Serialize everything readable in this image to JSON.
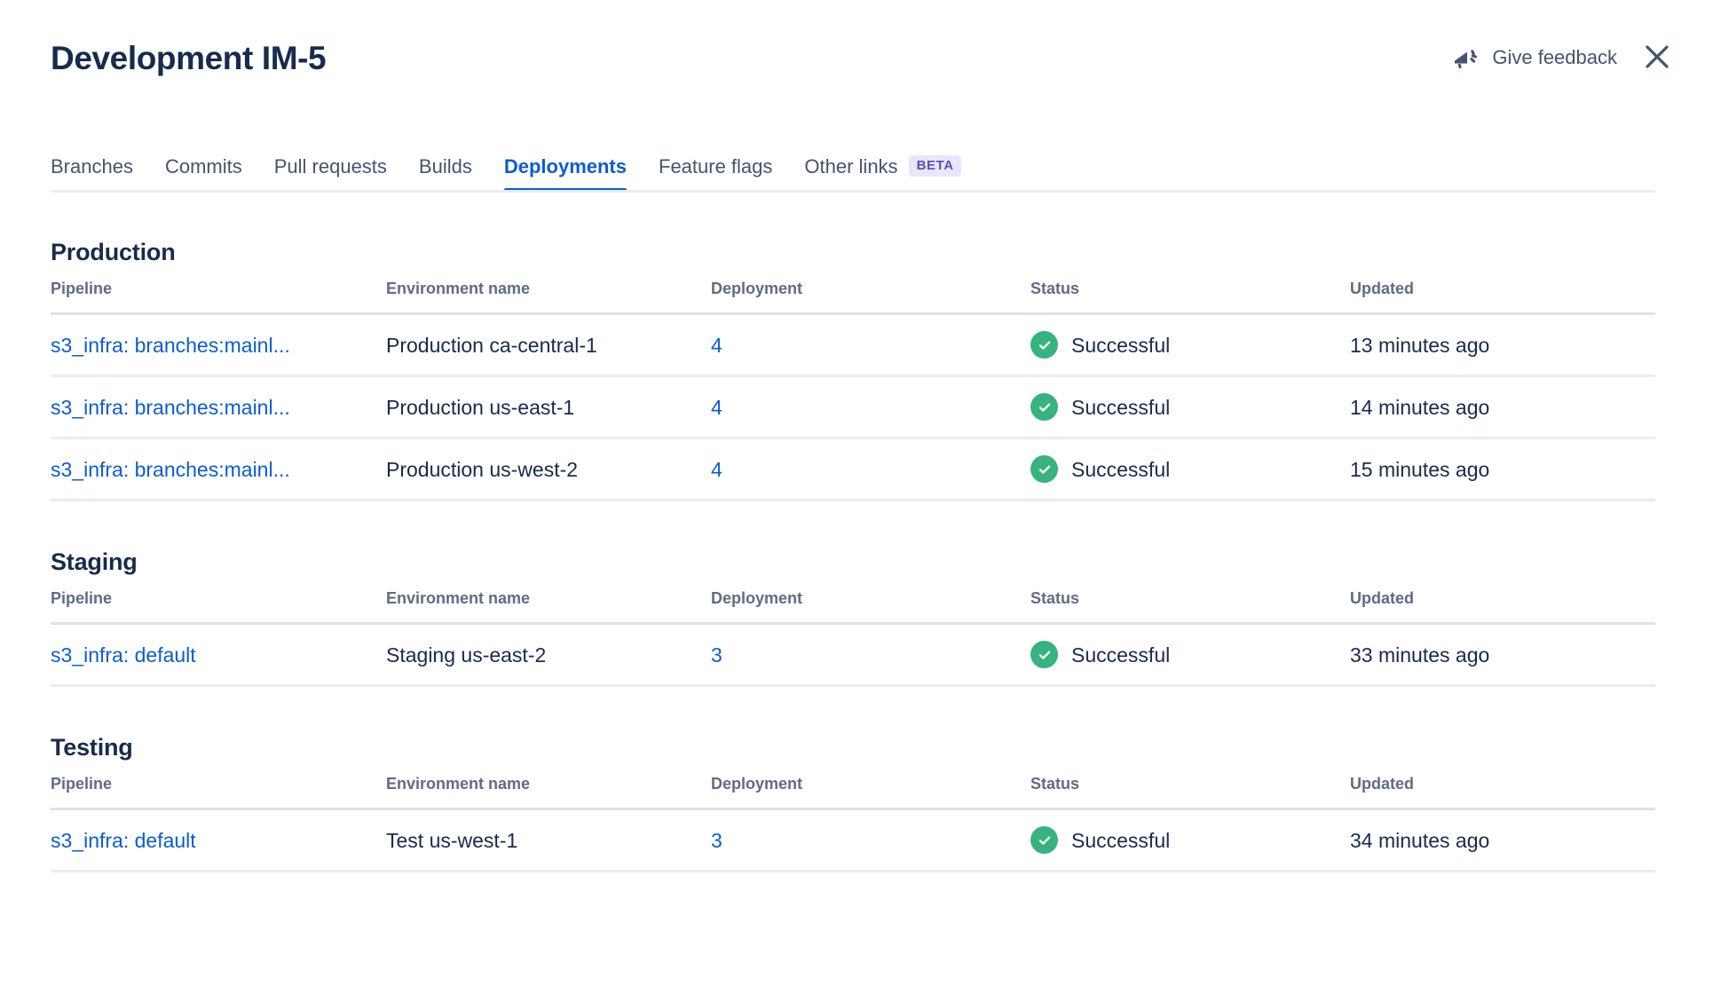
{
  "header": {
    "title": "Development IM-5",
    "feedback_label": "Give feedback",
    "feedback_icon": "megaphone-icon",
    "close_icon": "close-icon"
  },
  "tabs": [
    {
      "label": "Branches",
      "active": false,
      "badge": null
    },
    {
      "label": "Commits",
      "active": false,
      "badge": null
    },
    {
      "label": "Pull requests",
      "active": false,
      "badge": null
    },
    {
      "label": "Builds",
      "active": false,
      "badge": null
    },
    {
      "label": "Deployments",
      "active": true,
      "badge": null
    },
    {
      "label": "Feature flags",
      "active": false,
      "badge": null
    },
    {
      "label": "Other links",
      "active": false,
      "badge": "BETA"
    }
  ],
  "columns": [
    "Pipeline",
    "Environment name",
    "Deployment",
    "Status",
    "Updated"
  ],
  "sections": [
    {
      "title": "Production",
      "rows": [
        {
          "pipeline": "s3_infra: branches:mainl...",
          "environment": "Production ca-central-1",
          "deployment": "4",
          "status": "Successful",
          "status_icon": "check-circle-icon",
          "updated": "13 minutes ago"
        },
        {
          "pipeline": "s3_infra: branches:mainl...",
          "environment": "Production us-east-1",
          "deployment": "4",
          "status": "Successful",
          "status_icon": "check-circle-icon",
          "updated": "14 minutes ago"
        },
        {
          "pipeline": "s3_infra: branches:mainl...",
          "environment": "Production us-west-2",
          "deployment": "4",
          "status": "Successful",
          "status_icon": "check-circle-icon",
          "updated": "15 minutes ago"
        }
      ]
    },
    {
      "title": "Staging",
      "rows": [
        {
          "pipeline": "s3_infra: default",
          "environment": "Staging us-east-2",
          "deployment": "3",
          "status": "Successful",
          "status_icon": "check-circle-icon",
          "updated": "33 minutes ago"
        }
      ]
    },
    {
      "title": "Testing",
      "rows": [
        {
          "pipeline": "s3_infra: default",
          "environment": "Test us-west-1",
          "deployment": "3",
          "status": "Successful",
          "status_icon": "check-circle-icon",
          "updated": "34 minutes ago"
        }
      ]
    }
  ],
  "colors": {
    "link": "#0B5CD5",
    "title": "#172B4D",
    "muted": "#5E6C84",
    "success": "#36B37E",
    "beta_bg": "#E9E6FC",
    "beta_fg": "#5E4DB2",
    "divider": "#EBECF0"
  }
}
